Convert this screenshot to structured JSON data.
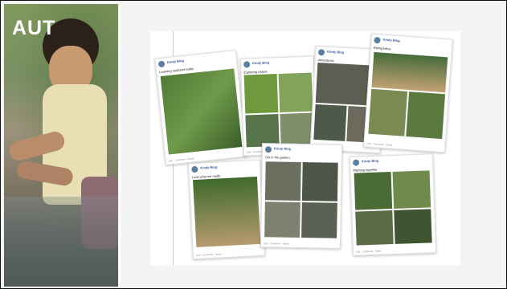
{
  "logo_text": "AUT",
  "posts": [
    {
      "author": "Kindy Blog",
      "text": "Learning outdoors today"
    },
    {
      "author": "Kindy Blog",
      "text": "Exploring nature"
    },
    {
      "author": "Kindy Blog",
      "text": "Adventures"
    },
    {
      "author": "Kindy Blog",
      "text": "Riding bikes"
    },
    {
      "author": "Kindy Blog",
      "text": "Look what we made"
    },
    {
      "author": "Kindy Blog",
      "text": "Out in the garden"
    },
    {
      "author": "Kindy Blog",
      "text": "Planting together"
    }
  ],
  "post_footer": "Like · Comment · Share"
}
